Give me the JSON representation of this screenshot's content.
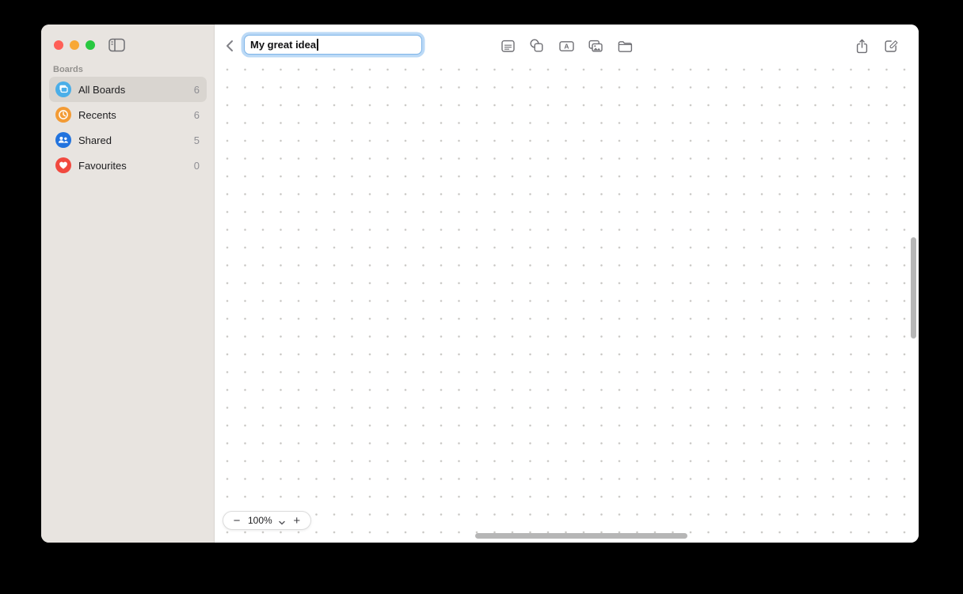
{
  "window": {
    "titlebar": {
      "close_button": "close",
      "minimize_button": "minimize",
      "zoom_button": "zoom"
    },
    "sidebar": {
      "section_label": "Boards",
      "items": [
        {
          "label": "All Boards",
          "count": "6",
          "icon": "all-boards-icon",
          "color": "#4aaee8",
          "selected": true
        },
        {
          "label": "Recents",
          "count": "6",
          "icon": "recents-clock-icon",
          "color": "#f39b35",
          "selected": false
        },
        {
          "label": "Shared",
          "count": "5",
          "icon": "shared-people-icon",
          "color": "#2273de",
          "selected": false
        },
        {
          "label": "Favourites",
          "count": "0",
          "icon": "favourites-heart-icon",
          "color": "#f1493f",
          "selected": false
        }
      ]
    },
    "toolbar": {
      "title_value": "My great idea",
      "tools": [
        "note-icon",
        "shapes-icon",
        "text-box-icon",
        "media-icon",
        "insert-file-icon"
      ],
      "actions": [
        "share-icon",
        "new-board-icon"
      ]
    },
    "zoom_control": {
      "minus_label": "−",
      "level": "100%",
      "plus_label": "+"
    },
    "colors": {
      "sidebar_bg": "#e8e4e0",
      "selected_row_bg": "#d9d5d0",
      "focus_ring": "#69aaeb",
      "traffic_red": "#ff5f57",
      "traffic_yellow": "#f8a836",
      "traffic_green": "#28c840",
      "canvas_dot": "#c7c5c2"
    }
  }
}
